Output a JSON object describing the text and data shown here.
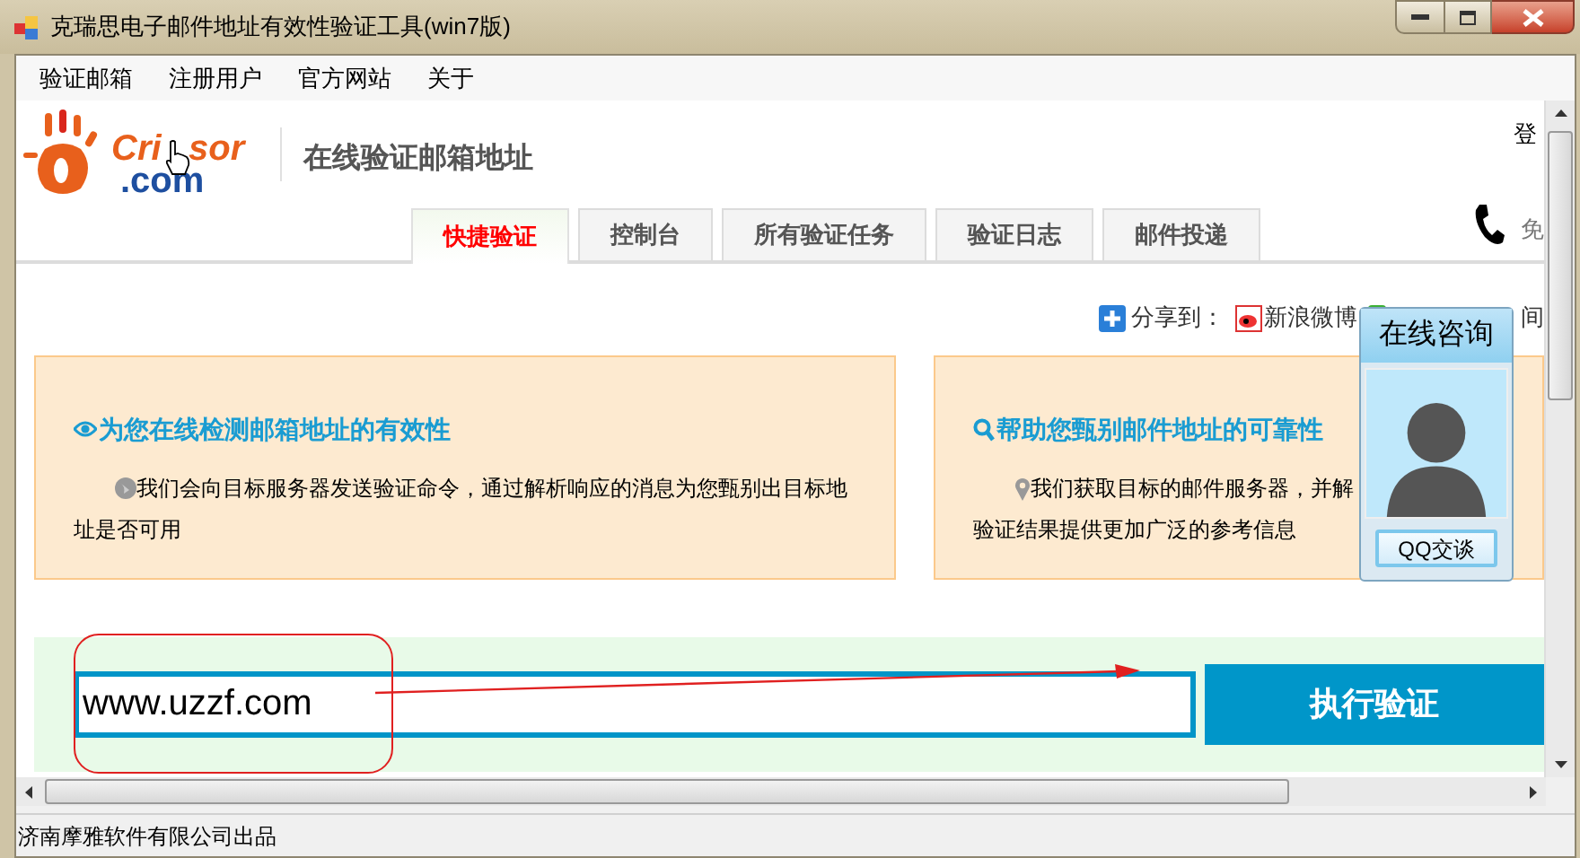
{
  "window": {
    "title": "克瑞思电子邮件地址有效性验证工具(win7版)"
  },
  "menu": [
    {
      "label": "验证邮箱"
    },
    {
      "label": "注册用户"
    },
    {
      "label": "官方网站"
    },
    {
      "label": "关于"
    }
  ],
  "header": {
    "logo": {
      "text_1": "Cri",
      "text_2": "sor",
      "text_3": ".com"
    },
    "title": "在线验证邮箱地址",
    "login_text": "登",
    "phone_text": "免"
  },
  "tabs": [
    {
      "label": "快捷验证",
      "selected": true
    },
    {
      "label": "控制台",
      "selected": false
    },
    {
      "label": "所有验证任务",
      "selected": false
    },
    {
      "label": "验证日志",
      "selected": false
    },
    {
      "label": "邮件投递",
      "selected": false
    }
  ],
  "share": {
    "label": "分享到：",
    "weibo": "新浪微博",
    "other": "间"
  },
  "cards": [
    {
      "kind": "eye",
      "title": "为您在线检测邮箱地址的有效性",
      "lines": [
        "我们会向目标服务器发送验证命令，通过解析响应的消息为您甄别出目标地",
        "址是否可用"
      ]
    },
    {
      "kind": "search",
      "title": "帮助您甄别邮件地址的可靠性",
      "lines": [
        "我们获取目标的邮件服务器，并解",
        "验证结果提供更加广泛的参考信息"
      ]
    }
  ],
  "consult": {
    "title": "在线咨询",
    "button": "QQ交谈"
  },
  "verify": {
    "value": "www.uzzf.com",
    "button": "执行验证"
  },
  "status_bar": {
    "text": "济南摩雅软件有限公司出品"
  }
}
